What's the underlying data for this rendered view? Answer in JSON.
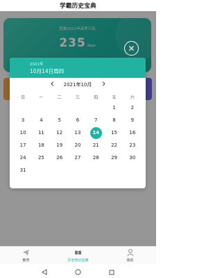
{
  "app": {
    "title": "学霸历史宝典"
  },
  "banner": {
    "countdown_label": "距离2022年高考只有",
    "days": "235",
    "unit": "days"
  },
  "dialog": {
    "header_year": "2021年",
    "header_date": "10月14日周四",
    "month_label": "2021年10月",
    "prev_icon": "chevron-left-icon",
    "next_icon": "chevron-right-icon",
    "weekdays": [
      "日",
      "一",
      "二",
      "三",
      "四",
      "五",
      "六"
    ],
    "days": [
      "",
      "",
      "",
      "",
      "",
      "1",
      "2",
      "3",
      "4",
      "5",
      "6",
      "7",
      "8",
      "9",
      "10",
      "11",
      "12",
      "13",
      "14",
      "15",
      "16",
      "17",
      "18",
      "19",
      "20",
      "21",
      "22",
      "23",
      "24",
      "25",
      "26",
      "27",
      "28",
      "29",
      "30",
      "31"
    ],
    "selected_day": "14"
  },
  "close_icon": "close-icon",
  "bottom_nav": [
    {
      "label": "教育",
      "icon": "paper-plane-icon"
    },
    {
      "label": "历史知识宝典",
      "icon": "book-icon"
    },
    {
      "label": "我的",
      "icon": "user-icon"
    }
  ],
  "colors": {
    "accent": "#20b3a1",
    "orange_card": "#f0a23c",
    "purple_card": "#6a63d9"
  }
}
